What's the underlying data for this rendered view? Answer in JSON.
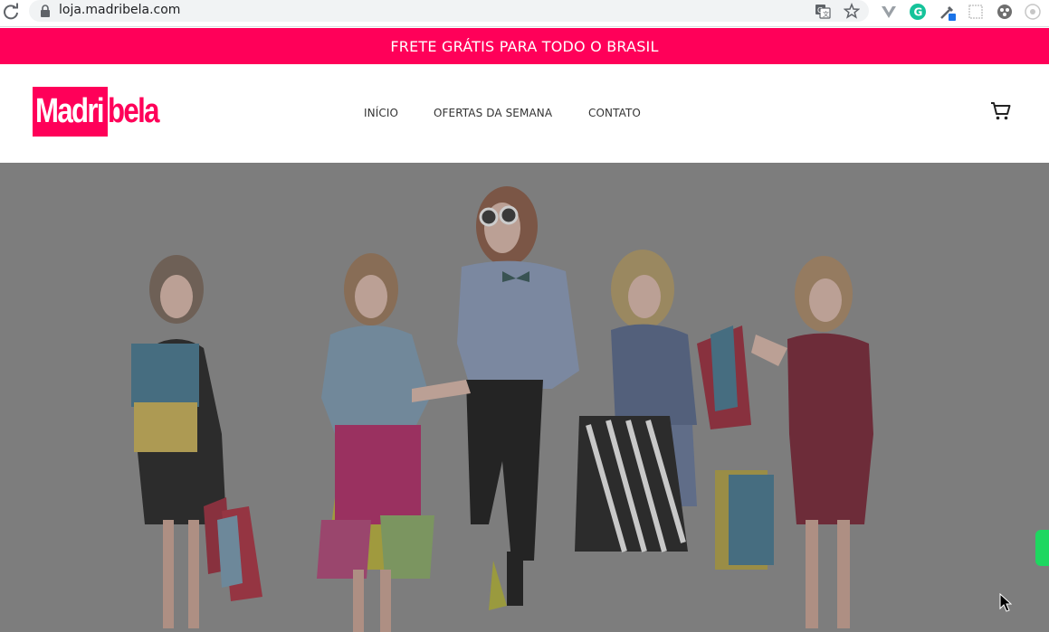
{
  "browser": {
    "url": "loja.madribela.com",
    "icons": [
      "reload-icon",
      "lock-icon",
      "translate-icon",
      "bookmark-star-icon",
      "vue-devtools-icon",
      "grammarly-icon",
      "eyedropper-icon",
      "extension-icon",
      "extension-icon-2",
      "extension-icon-3"
    ]
  },
  "promo": {
    "text": "FRETE GRÁTIS PARA TODO O BRASIL",
    "color": "#ff0059"
  },
  "header": {
    "logo_part1": "Madri",
    "logo_part2": "bela",
    "nav": [
      {
        "label": "INÍCIO"
      },
      {
        "label": "OFERTAS DA SEMANA"
      },
      {
        "label": "CONTATO"
      }
    ],
    "cart_icon": "shopping-cart-icon"
  },
  "hero": {
    "overlay_color": "#7d7d7d",
    "image": "hero-image-five-women-shopping-bags"
  },
  "widgets": {
    "whatsapp_color": "#1ed760"
  }
}
